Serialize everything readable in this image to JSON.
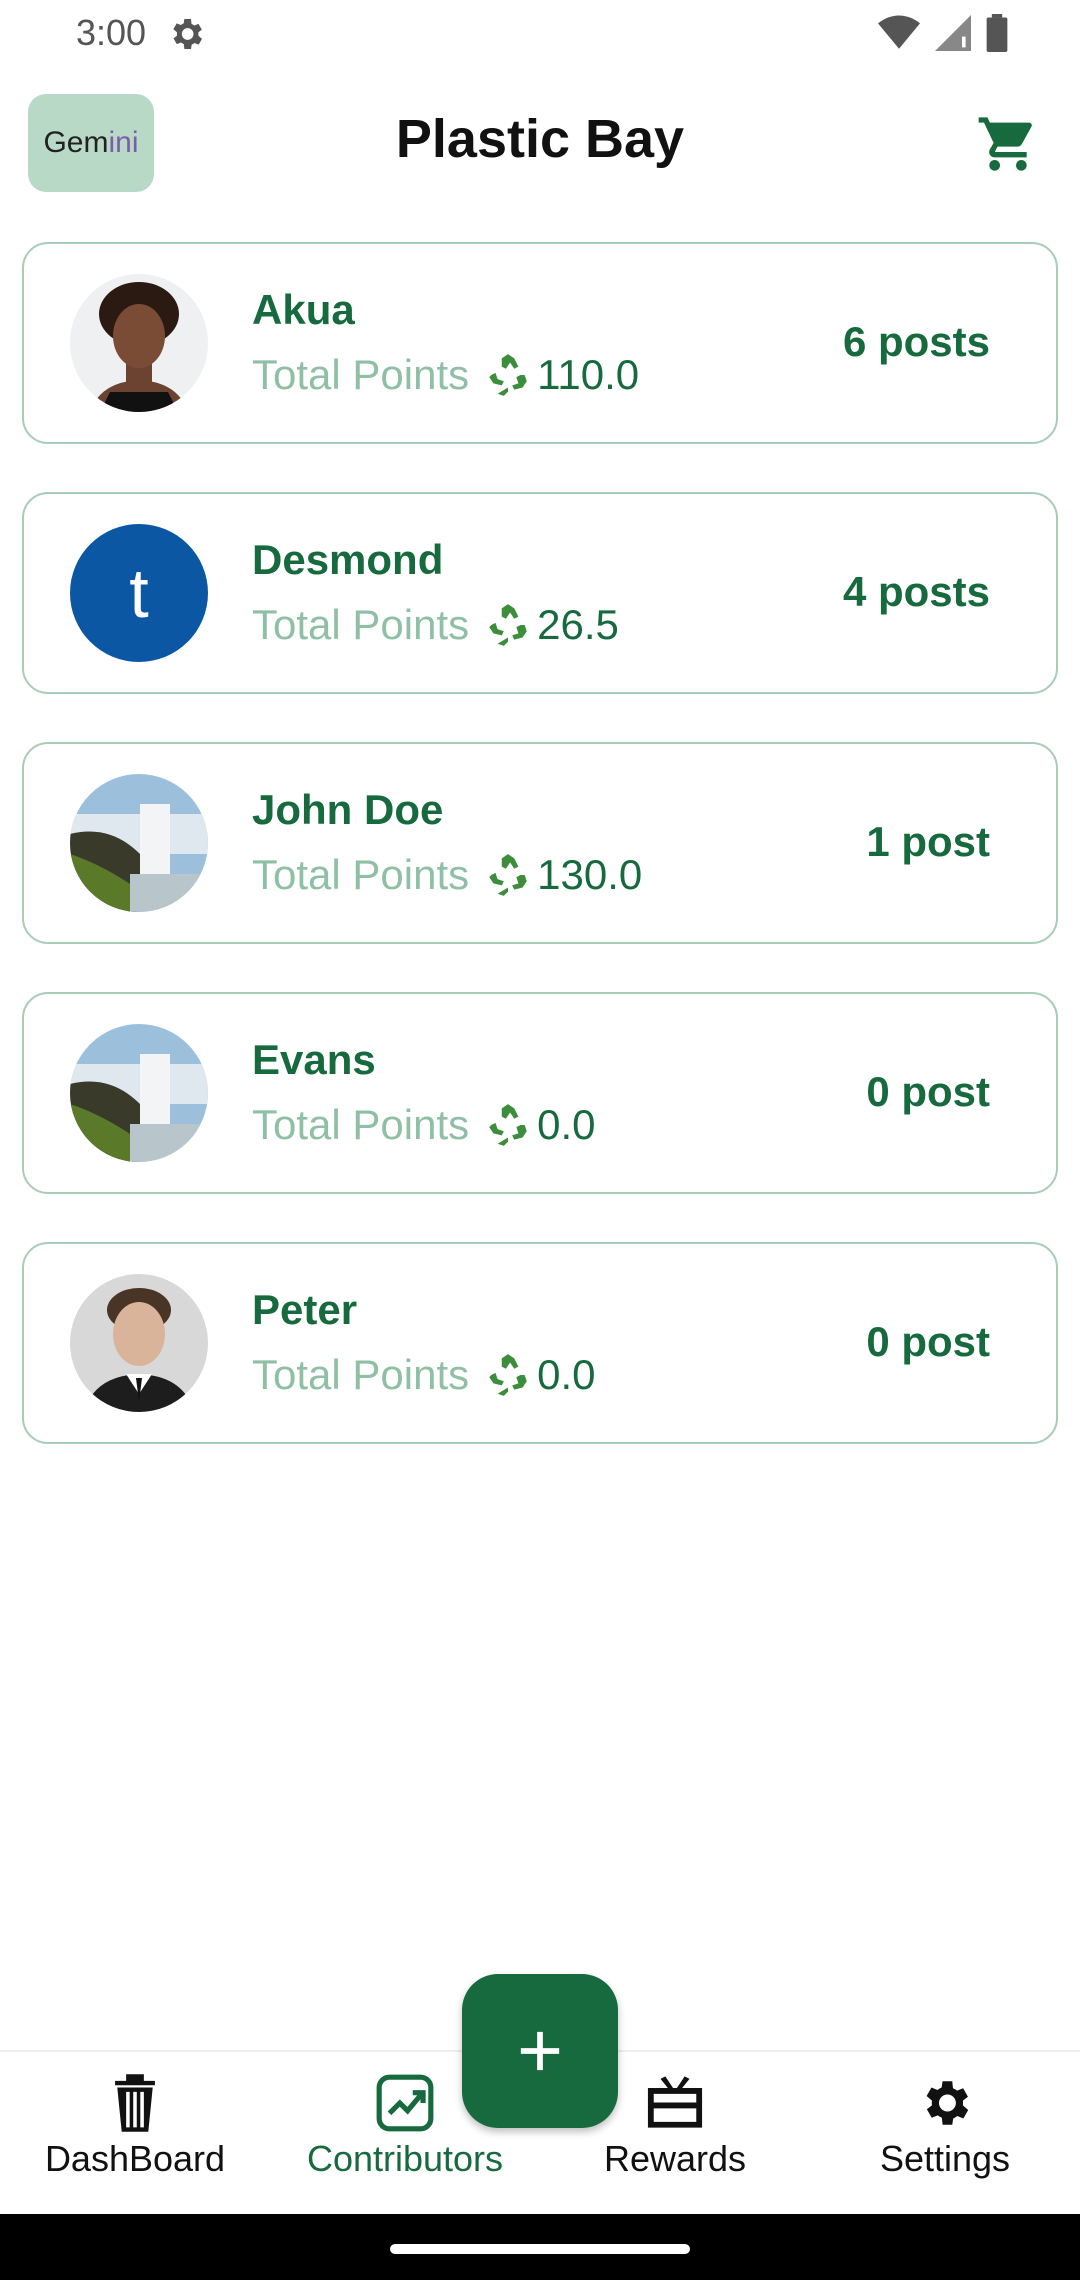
{
  "status_bar": {
    "time": "3:00"
  },
  "app_bar": {
    "gemini_label_a": "Gem",
    "gemini_label_b": "i",
    "gemini_label_c": "ni",
    "title": "Plastic Bay"
  },
  "contributors": [
    {
      "name": "Akua",
      "points_label": "Total Points",
      "points": "110.0",
      "posts": "6 posts",
      "avatar": "photo-woman"
    },
    {
      "name": "Desmond",
      "points_label": "Total Points",
      "points": "26.5",
      "posts": "4 posts",
      "avatar": "letter",
      "avatar_letter": "t"
    },
    {
      "name": "John Doe",
      "points_label": "Total Points",
      "points": "130.0",
      "posts": "1 post",
      "avatar": "photo-waterfall"
    },
    {
      "name": "Evans",
      "points_label": "Total Points",
      "points": "0.0",
      "posts": "0 post",
      "avatar": "photo-waterfall"
    },
    {
      "name": "Peter",
      "points_label": "Total Points",
      "points": "0.0",
      "posts": "0 post",
      "avatar": "photo-man"
    }
  ],
  "bottom_nav": {
    "items": [
      {
        "label": "DashBoard",
        "icon": "trash-bin-icon"
      },
      {
        "label": "Contributors",
        "icon": "trending-chart-icon",
        "active": true
      },
      {
        "label": "Rewards",
        "icon": "gift-card-icon"
      },
      {
        "label": "Settings",
        "icon": "gear-icon"
      }
    ]
  },
  "colors": {
    "primary": "#176a3e",
    "muted_green": "#8fbfa5",
    "card_border": "#a9ccb9",
    "gemini_bg": "#b9d9c7",
    "avatar_letter_bg": "#0b57a4"
  }
}
